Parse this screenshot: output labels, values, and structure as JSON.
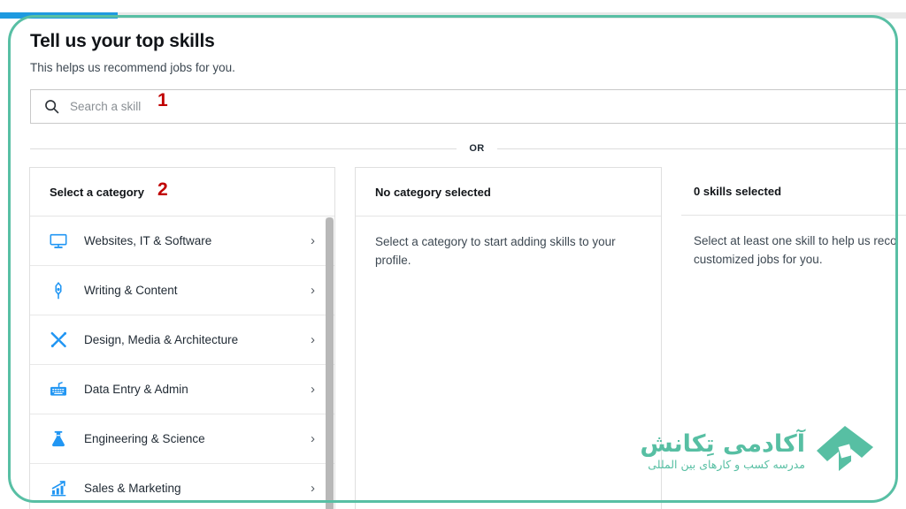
{
  "progress": {
    "label": "onboarding-progress",
    "percent": 13,
    "fill_color": "#1e9ae0",
    "track_color": "#e8e8e8"
  },
  "frame": {
    "highlight_color": "#58bfa4"
  },
  "header": {
    "title": "Tell us your top skills",
    "subtitle": "This helps us recommend jobs for you."
  },
  "search": {
    "placeholder": "Search a skill",
    "value": "",
    "icon": "search-icon"
  },
  "divider": {
    "label": "OR"
  },
  "annotations": [
    {
      "id": "1",
      "text": "1",
      "color": "#c00000",
      "target": "search-input"
    },
    {
      "id": "2",
      "text": "2",
      "color": "#c00000",
      "target": "category-panel"
    }
  ],
  "category_panel": {
    "title": "Select a category",
    "icon_color": "#2196f3",
    "items": [
      {
        "label": "Websites, IT & Software",
        "icon": "monitor-icon"
      },
      {
        "label": "Writing & Content",
        "icon": "fountain-pen-icon"
      },
      {
        "label": "Design, Media & Architecture",
        "icon": "pencil-brush-icon"
      },
      {
        "label": "Data Entry & Admin",
        "icon": "keyboard-icon"
      },
      {
        "label": "Engineering & Science",
        "icon": "flask-icon"
      },
      {
        "label": "Sales & Marketing",
        "icon": "bar-chart-arrow-icon"
      }
    ],
    "chevron": "›"
  },
  "selected_category_panel": {
    "title": "No category selected",
    "body": "Select a category to start adding skills to your profile."
  },
  "selected_skills_panel": {
    "title": "0 skills selected",
    "body_line1": "Select at least one skill to help us reco",
    "body_line2": "customized jobs for you."
  },
  "watermark": {
    "title": "آکادمی تِکانش",
    "subtitle": "مدرسه کسب و کارهای بین المللی",
    "color": "#57bfa3"
  }
}
